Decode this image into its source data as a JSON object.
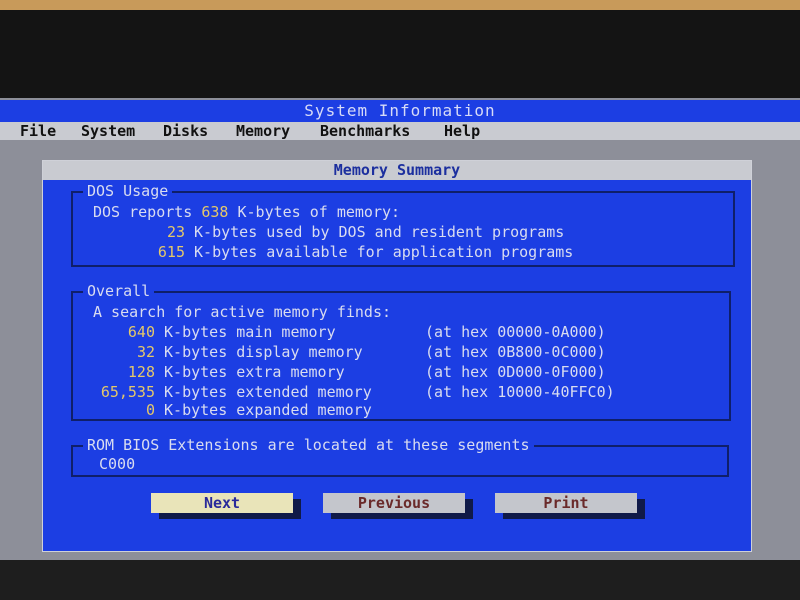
{
  "window": {
    "title": "System Information"
  },
  "menu": [
    "File",
    "System",
    "Disks",
    "Memory",
    "Benchmarks",
    "Help"
  ],
  "dialog": {
    "title": "Memory Summary",
    "dos_usage": {
      "legend": "DOS Usage",
      "line1_pre": "DOS reports ",
      "line1_num": "638",
      "line1_post": " K-bytes of memory:",
      "rows": [
        {
          "num": "23",
          "text": " K-bytes used by DOS and resident programs"
        },
        {
          "num": "615",
          "text": " K-bytes available for application programs"
        }
      ]
    },
    "overall": {
      "legend": "Overall",
      "intro": "A search for active memory finds:",
      "rows": [
        {
          "num": "640",
          "text": " K-bytes main memory",
          "hex": "(at hex 00000-0A000)"
        },
        {
          "num": "32",
          "text": " K-bytes display memory",
          "hex": "(at hex 0B800-0C000)"
        },
        {
          "num": "128",
          "text": " K-bytes extra memory",
          "hex": "(at hex 0D000-0F000)"
        },
        {
          "num": "65,535",
          "text": " K-bytes extended memory",
          "hex": "(at hex 10000-40FFC0)"
        },
        {
          "num": "0",
          "text": " K-bytes expanded memory",
          "hex": ""
        }
      ]
    },
    "rom": {
      "legend": "ROM BIOS Extensions are located at these segments",
      "value": "C000"
    },
    "buttons": {
      "next": "Next",
      "previous": "Previous",
      "print": "Print"
    }
  }
}
